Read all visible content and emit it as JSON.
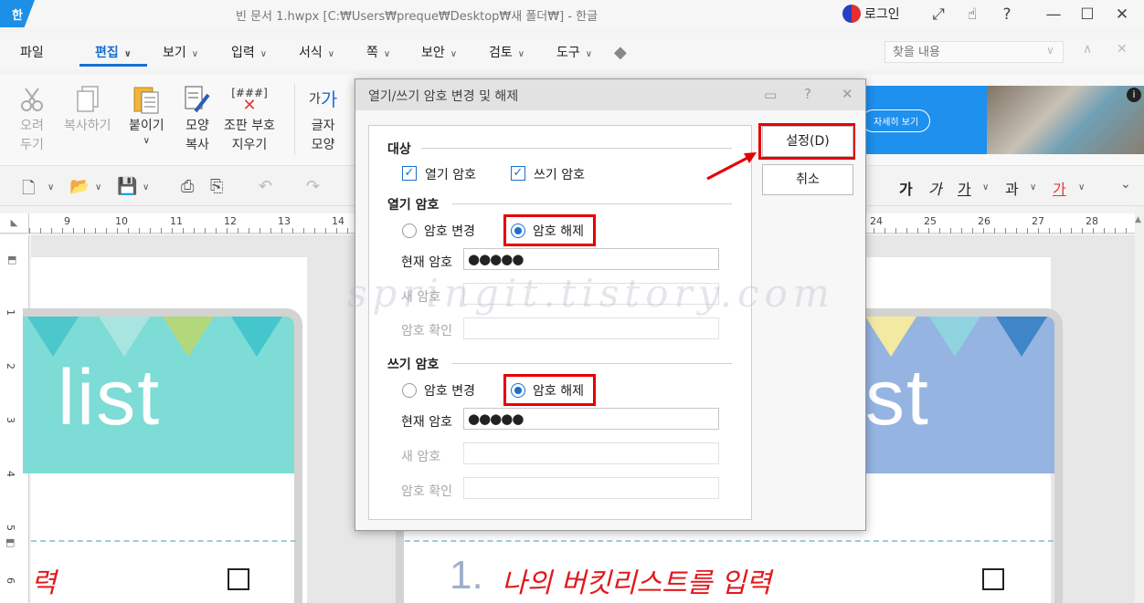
{
  "app": {
    "logo": "한",
    "window_title": "빈 문서 1.hwpx [C:₩Users₩preque₩Desktop₩새 폴더₩] - 한글",
    "login_label": "로그인"
  },
  "menu": {
    "items": [
      "파일",
      "편집",
      "보기",
      "입력",
      "서식",
      "쪽",
      "보안",
      "검토",
      "도구"
    ],
    "search_placeholder": "찾을 내용"
  },
  "ribbon": {
    "cut": [
      "오려",
      "두기"
    ],
    "copy": "복사하기",
    "paste": "붙이기",
    "shape_copy": [
      "모양",
      "복사"
    ],
    "clear_format": [
      "조판 부호",
      "지우기"
    ],
    "clear_icon_text": "[###]",
    "char_shape": [
      "글자",
      "모양"
    ],
    "char_icon_small": "가",
    "char_icon_big": "가",
    "ad_button": "자세히 보기"
  },
  "toolbar": {
    "format_glyphs": [
      "가",
      "가",
      "가",
      "과",
      "가"
    ]
  },
  "ruler": {
    "h_left": [
      "9",
      "10",
      "11",
      "12",
      "13",
      "14"
    ],
    "h_right": [
      "24",
      "25",
      "26",
      "27",
      "28"
    ],
    "v": [
      "1",
      "2",
      "3",
      "4",
      "5",
      "6"
    ]
  },
  "doc": {
    "left_card_text": "list",
    "right_card_text": "st",
    "left_red": "력",
    "right_number": "1.",
    "right_red": "나의 버킷리스트를 입력"
  },
  "dialog": {
    "title": "열기/쓰기 암호 변경 및 해제",
    "target_section": "대상",
    "open_pw_check": "열기 암호",
    "write_pw_check": "쓰기 암호",
    "open_section": "열기 암호",
    "write_section": "쓰기 암호",
    "change_label": "암호 변경",
    "remove_label": "암호 해제",
    "current_pw": "현재 암호",
    "new_pw": "새 암호",
    "confirm_pw": "암호 확인",
    "open_current_value": "●●●●●",
    "write_current_value": "●●●●●",
    "ok_button": "설정(D)",
    "cancel_button": "취소"
  },
  "watermark": "springit.tistory.com",
  "colors": {
    "accent": "#1570d0",
    "highlight": "#e50000",
    "teal_card": "#7ddcd5",
    "blue_card": "#95b4e2"
  }
}
